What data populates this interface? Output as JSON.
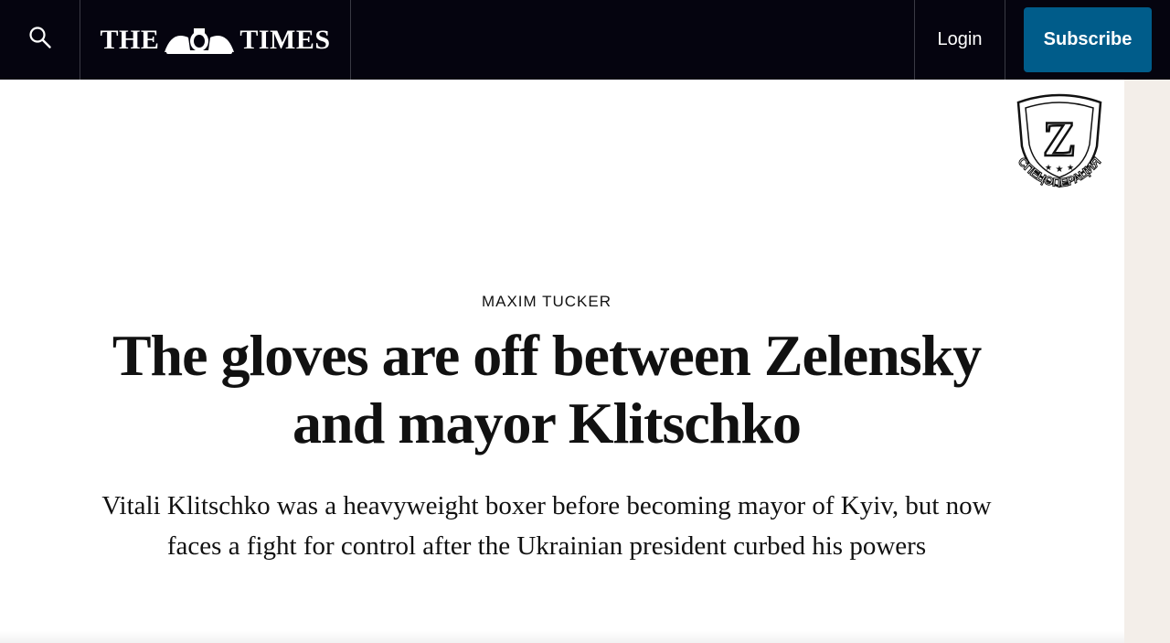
{
  "header": {
    "logo_left": "THE",
    "logo_right": "TIMES",
    "login_label": "Login",
    "subscribe_label": "Subscribe",
    "search_icon": "search-icon",
    "brand_color": "#05040f",
    "subscribe_color": "#005c8a"
  },
  "stamp": {
    "letter": "Z",
    "caption": "СПЕЦОПЕРАЦИЯ"
  },
  "article": {
    "byline": "MAXIM TUCKER",
    "headline": "The gloves are off between Zelensky and mayor Klitschko",
    "standfirst": "Vitali Klitschko was a heavyweight boxer before becoming mayor of Kyiv, but now faces a fight for control after the Ukrainian president curbed his powers"
  }
}
